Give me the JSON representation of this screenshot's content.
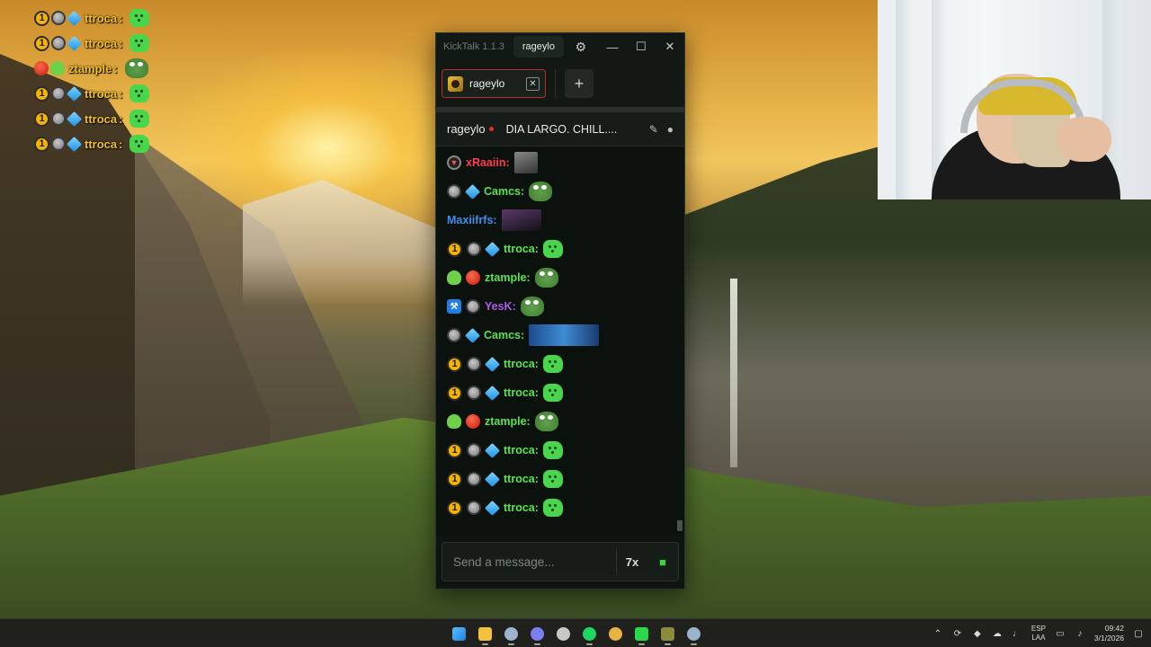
{
  "overlay_chat": [
    {
      "badges": [
        "one",
        "gray",
        "cube"
      ],
      "name": "ttroca",
      "name_color": "#f6c11d",
      "emote": "blob"
    },
    {
      "badges": [
        "one",
        "gray",
        "cube"
      ],
      "name": "ttroca",
      "name_color": "#f6c11d",
      "emote": "blob"
    },
    {
      "badges": [
        "red",
        "alien"
      ],
      "name": "ztample",
      "name_color": "#f6c11d",
      "emote": "pepe"
    },
    {
      "badges": [
        "one",
        "gray",
        "cube"
      ],
      "name": "ttroca",
      "name_color": "#f6c11d",
      "emote": "blob"
    },
    {
      "badges": [
        "one",
        "gray",
        "cube"
      ],
      "name": "ttroca",
      "name_color": "#f6c11d",
      "emote": "blob"
    },
    {
      "badges": [
        "one",
        "gray",
        "cube"
      ],
      "name": "ttroca",
      "name_color": "#f6c11d",
      "emote": "blob"
    }
  ],
  "window": {
    "app_title": "KickTalk 1.1.3",
    "title_user": "rageylo",
    "settings_icon": "⚙",
    "min_icon": "—",
    "max_icon": "☐",
    "close_icon": "✕"
  },
  "tabs": {
    "active_tab_label": "rageylo",
    "close_icon": "✕",
    "add_icon": "+"
  },
  "channel": {
    "name": "rageylo",
    "stream_title": "DIA LARGO. CHILL....",
    "pin_icon": "✎",
    "user_icon": "●"
  },
  "messages": [
    {
      "badges": [
        "dark"
      ],
      "name": "xRaaiin:",
      "name_color": "#ff3b4e",
      "emote": "img"
    },
    {
      "badges": [
        "gray",
        "cube"
      ],
      "name": "Camcs:",
      "name_color": "#5ae34e",
      "emote": "pepe"
    },
    {
      "badges": [],
      "name": "Maxiifrfs:",
      "name_color": "#3a8ff0",
      "emote": "dark"
    },
    {
      "badges": [
        "one",
        "gray",
        "cube"
      ],
      "name": "ttroca:",
      "name_color": "#5ae34e",
      "emote": "blob"
    },
    {
      "badges": [
        "alien",
        "red"
      ],
      "name": "ztample:",
      "name_color": "#5ae34e",
      "emote": "pepe"
    },
    {
      "badges": [
        "pin",
        "gray"
      ],
      "name": "YesK:",
      "name_color": "#b15ce8",
      "emote": "pepe"
    },
    {
      "badges": [
        "gray",
        "cube"
      ],
      "name": "Camcs:",
      "name_color": "#5ae34e",
      "emote": "wide"
    },
    {
      "badges": [
        "one",
        "gray",
        "cube"
      ],
      "name": "ttroca:",
      "name_color": "#5ae34e",
      "emote": "blob"
    },
    {
      "badges": [
        "one",
        "gray",
        "cube"
      ],
      "name": "ttroca:",
      "name_color": "#5ae34e",
      "emote": "blob"
    },
    {
      "badges": [
        "alien",
        "red"
      ],
      "name": "ztample:",
      "name_color": "#5ae34e",
      "emote": "pepe"
    },
    {
      "badges": [
        "one",
        "gray",
        "cube"
      ],
      "name": "ttroca:",
      "name_color": "#5ae34e",
      "emote": "blob"
    },
    {
      "badges": [
        "one",
        "gray",
        "cube"
      ],
      "name": "ttroca:",
      "name_color": "#5ae34e",
      "emote": "blob"
    },
    {
      "badges": [
        "one",
        "gray",
        "cube"
      ],
      "name": "ttroca:",
      "name_color": "#5ae34e",
      "emote": "blob"
    }
  ],
  "input": {
    "placeholder": "Send a message...",
    "value": "",
    "kicktalk_emotes_icon": "7x",
    "kick_emotes_icon": "■"
  },
  "taskbar": {
    "apps": [
      {
        "name": "start-icon",
        "color": "#3a9df0"
      },
      {
        "name": "file-explorer-icon",
        "color": "#f2c23a"
      },
      {
        "name": "steam-icon",
        "color": "#9bb3cc"
      },
      {
        "name": "discord-icon",
        "color": "#7b7ff0"
      },
      {
        "name": "obs-icon",
        "color": "#c8c8c8"
      },
      {
        "name": "spotify-icon",
        "color": "#1ed760"
      },
      {
        "name": "chrome-icon",
        "color": "#e8b341"
      },
      {
        "name": "kick-icon",
        "color": "#2bd84a"
      },
      {
        "name": "minecraft-icon",
        "color": "#8a8c3c"
      },
      {
        "name": "steam-2-icon",
        "color": "#9bb3cc"
      }
    ],
    "language_line1": "ESP",
    "language_line2": "LAA",
    "time": "09:42",
    "date": "3/1/2026"
  },
  "colors": {
    "accent_tab_border": "#b2312b",
    "kick_green": "#3cd33c",
    "live_dot": "#e63030"
  }
}
